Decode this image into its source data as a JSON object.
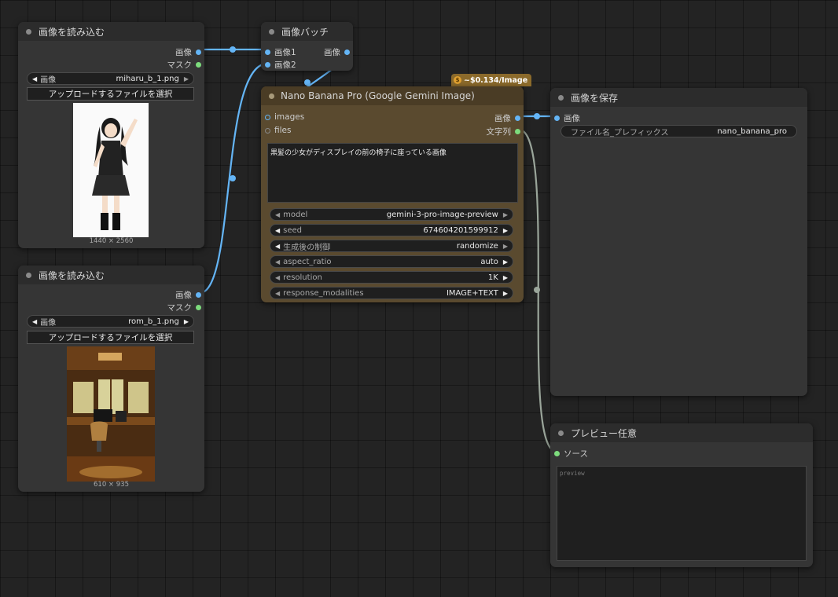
{
  "load1": {
    "title": "画像を読み込む",
    "out_image": "画像",
    "out_mask": "マスク",
    "widget_label": "画像",
    "widget_value": "miharu_b_1.png",
    "upload_label": "アップロードするファイルを選択",
    "image_size": "1440 × 2560"
  },
  "load2": {
    "title": "画像を読み込む",
    "out_image": "画像",
    "out_mask": "マスク",
    "widget_label": "画像",
    "widget_value": "rom_b_1.png",
    "upload_label": "アップロードするファイルを選択",
    "image_size": "610 × 935"
  },
  "batch": {
    "title": "画像バッチ",
    "in1": "画像1",
    "in2": "画像2",
    "out": "画像"
  },
  "nano": {
    "badge": "~$0.134/Image",
    "title": "Nano Banana Pro (Google Gemini Image)",
    "in_images": "images",
    "in_files": "files",
    "out_image": "画像",
    "out_text": "文字列",
    "prompt": "黒髪の少女がディスプレイの前の椅子に座っている画像",
    "widgets": [
      {
        "label": "model",
        "value": "gemini-3-pro-image-preview"
      },
      {
        "label": "seed",
        "value": "674604201599912"
      },
      {
        "label": "生成後の制御",
        "value": "randomize"
      },
      {
        "label": "aspect_ratio",
        "value": "auto"
      },
      {
        "label": "resolution",
        "value": "1K"
      },
      {
        "label": "response_modalities",
        "value": "IMAGE+TEXT"
      }
    ]
  },
  "save": {
    "title": "画像を保存",
    "in_image": "画像",
    "widget_label": "ファイル名_プレフィックス",
    "widget_value": "nano_banana_pro"
  },
  "preview": {
    "title": "プレビュー任意",
    "in_source": "ソース",
    "placeholder": "preview"
  },
  "colors": {
    "canvas": "#232323",
    "node": "#353535",
    "nano_node": "#5a4a2f",
    "image_link": "#64b5f6",
    "string_link": "#9aa59a"
  }
}
